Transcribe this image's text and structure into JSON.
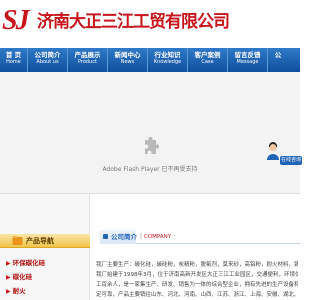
{
  "header": {
    "logo_mark": "SJ",
    "company_name": "济南大正三江工贸有限公司"
  },
  "nav": [
    {
      "cn": "首 页",
      "en": "Home"
    },
    {
      "cn": "公司简介",
      "en": "About us"
    },
    {
      "cn": "产品展示",
      "en": "Product"
    },
    {
      "cn": "新闻中心",
      "en": "News"
    },
    {
      "cn": "行业知识",
      "en": "Knowledge"
    },
    {
      "cn": "客户案例",
      "en": "Case"
    },
    {
      "cn": "留言反馈",
      "en": "Message"
    },
    {
      "cn": "公",
      "en": ""
    }
  ],
  "banner": {
    "plugin_message": "Adobe Flash Player 已不再受支持"
  },
  "online_service": {
    "button_label": "在线咨询"
  },
  "sidebar": {
    "title": "产品导航",
    "items": [
      {
        "label": "环保碳化硅"
      },
      {
        "label": "碳化硅"
      },
      {
        "label": "耐火"
      }
    ]
  },
  "about": {
    "title": "公司简介",
    "subtitle": "COMPANY",
    "lines": [
      "我厂主要生产：碳化硅，碳硅粉，炭精粉，脱氧剂，莫来砂，高铝粉，耐火材料，铸造辅料二氧化硅碳化硅等",
      "我厂始建于1998年3月，位于济南高新开发区大正三江工业园区，交通便利，环境优美，厂区占地面积十余亩，员",
      "工百余人，是一家集生产、研发、销售为一体的综合型企业，拥有先进的生产设备和完善的检测仪器，产品质量稳",
      "定可靠，产品主要销往山东、河北、河南、山西、江苏、浙江、上海、安徽、湖北、湖南、江西、福建、广东等地"
    ]
  },
  "colors": {
    "brand_red": "#c8161d",
    "nav_blue": "#1f64b7",
    "sidebar_gold": "#f0c44c"
  }
}
